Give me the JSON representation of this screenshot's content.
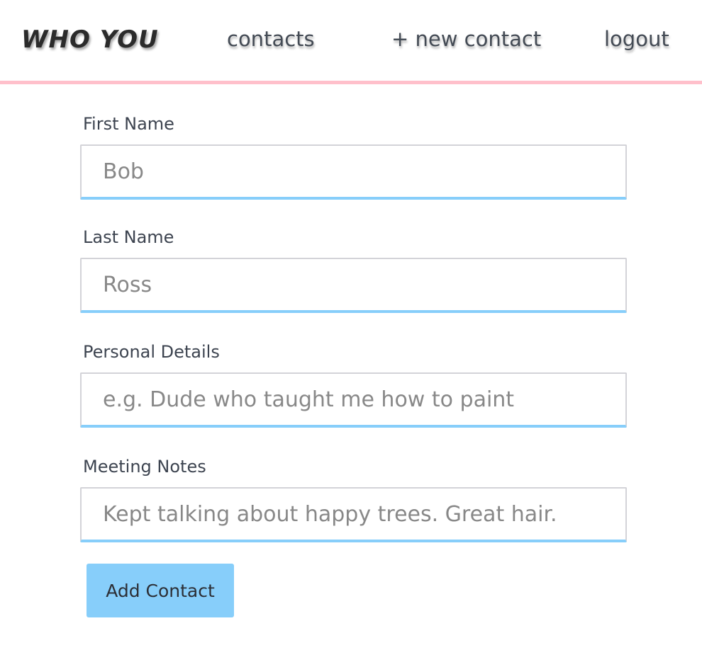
{
  "nav": {
    "brand": "WHO YOU",
    "contacts": "contacts",
    "new_contact": "+ new contact",
    "logout": "logout"
  },
  "form": {
    "first_name": {
      "label": "First Name",
      "value": "",
      "placeholder": "Bob"
    },
    "last_name": {
      "label": "Last Name",
      "value": "",
      "placeholder": "Ross"
    },
    "personal_details": {
      "label": "Personal Details",
      "value": "",
      "placeholder": "e.g. Dude who taught me how to paint"
    },
    "meeting_notes": {
      "label": "Meeting Notes",
      "value": "",
      "placeholder": "Kept talking about happy trees. Great hair."
    },
    "submit_label": "Add Contact"
  },
  "colors": {
    "accent": "#87cefa",
    "nav_border": "#ffc0cb",
    "text": "#3d4450"
  }
}
